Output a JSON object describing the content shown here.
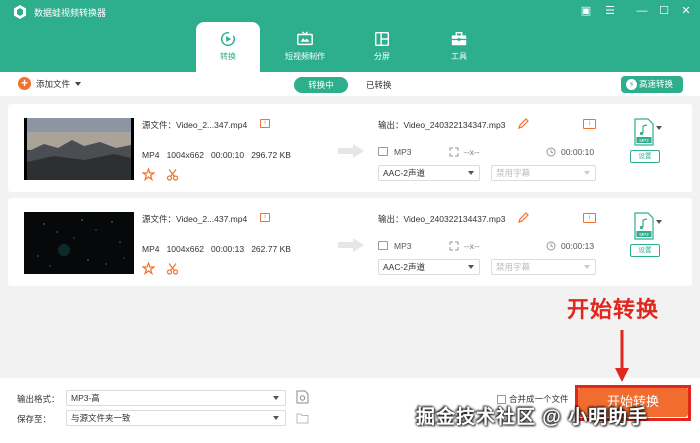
{
  "app": {
    "title": "数据蛙视频转换器"
  },
  "window_controls": [
    "▣",
    "☰",
    "—",
    "☐",
    "✕"
  ],
  "tabs": [
    {
      "label": "转换",
      "icon": "convert-icon",
      "active": true
    },
    {
      "label": "短视频制作",
      "icon": "tv-icon",
      "active": false
    },
    {
      "label": "分屏",
      "icon": "split-screen-icon",
      "active": false
    },
    {
      "label": "工具",
      "icon": "toolbox-icon",
      "active": false
    }
  ],
  "toolbar": {
    "add_file_label": "添加文件",
    "converting_label": "转换中",
    "converted_label": "已转换",
    "fast_convert_label": "高速转换"
  },
  "files": [
    {
      "source_label": "源文件：Video_2...347.mp4",
      "format": "MP4",
      "resolution": "1004x662",
      "duration": "00:00:10",
      "size": "296.72 KB",
      "output_label": "输出：Video_240322134347.mp3",
      "out_format": "MP3",
      "out_resolution": "--x--",
      "out_duration": "00:00:10",
      "audio": "AAC-2声道",
      "subtitle": "禁用字幕",
      "format_badge": "MP3",
      "settings_label": "设置"
    },
    {
      "source_label": "源文件：Video_2...437.mp4",
      "format": "MP4",
      "resolution": "1004x662",
      "duration": "00:00:13",
      "size": "262.77 KB",
      "output_label": "输出：Video_240322134437.mp3",
      "out_format": "MP3",
      "out_resolution": "--x--",
      "out_duration": "00:00:13",
      "audio": "AAC-2声道",
      "subtitle": "禁用字幕",
      "format_badge": "MP3",
      "settings_label": "设置"
    }
  ],
  "footer": {
    "output_format_label": "输出格式：",
    "output_format_value": "MP3-高",
    "save_to_label": "保存至：",
    "save_to_value": "与源文件夹一致",
    "merge_label": "合并成一个文件",
    "start_label": "开始转换"
  },
  "annotation": {
    "text": "开始转换",
    "color": "#e0271e"
  },
  "watermark": "掘金技术社区 @ 小明助手",
  "colors": {
    "brand": "#2dae8c",
    "accent": "#f26b2f"
  }
}
